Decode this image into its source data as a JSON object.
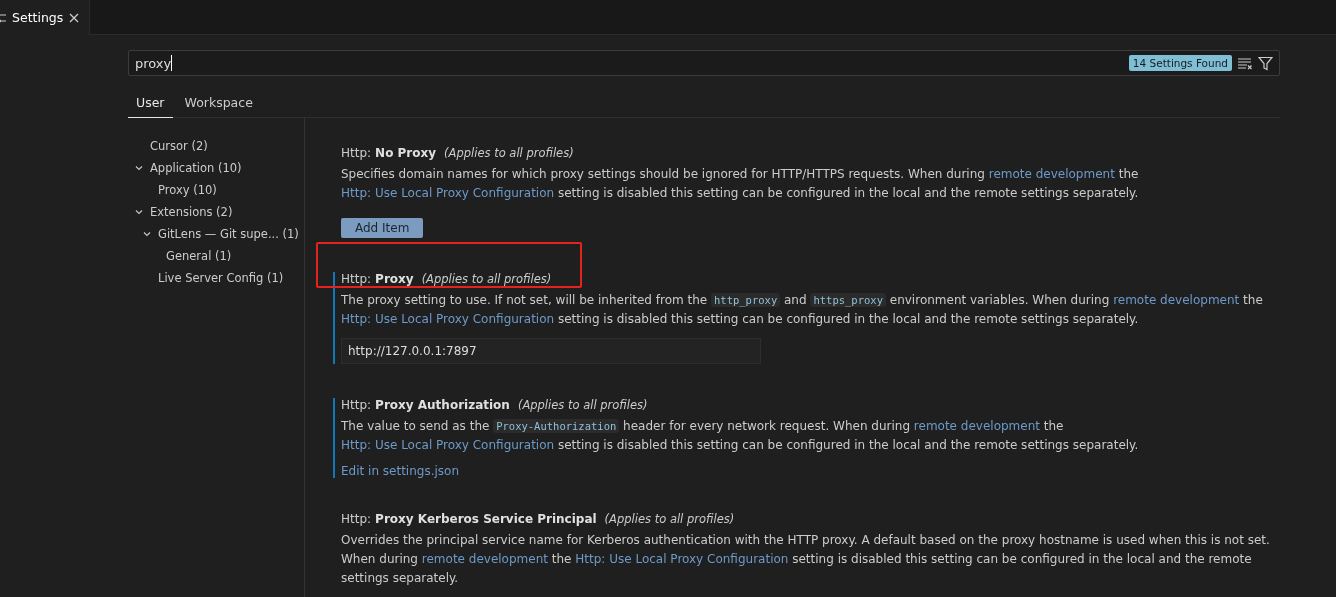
{
  "editor_tab": {
    "title": "Settings",
    "selected": true
  },
  "search": {
    "value": "proxy",
    "result_badge": "14 Settings Found"
  },
  "scope_tabs": [
    {
      "label": "User",
      "selected": true
    },
    {
      "label": "Workspace",
      "selected": false
    }
  ],
  "toc": [
    {
      "label": "Cursor (2)"
    },
    {
      "label": "Application (10)",
      "expanded": true,
      "children": [
        {
          "label": "Proxy (10)"
        }
      ]
    },
    {
      "label": "Extensions (2)",
      "expanded": true,
      "children": [
        {
          "label": "GitLens — Git supe... (1)",
          "expanded": true,
          "children": [
            {
              "label": "General (1)"
            }
          ]
        },
        {
          "label": "Live Server Config (1)"
        }
      ]
    }
  ],
  "settings": [
    {
      "category": "Http:",
      "name": "No Proxy",
      "scope": "(Applies to all profiles)",
      "focused": false,
      "highlighted": false,
      "description": [
        {
          "kind": "text",
          "text": "Specifies domain names for which proxy settings should be ignored for HTTP/HTTPS requests. When during "
        },
        {
          "kind": "link",
          "text": "remote development"
        },
        {
          "kind": "text",
          "text": " the "
        },
        {
          "kind": "link",
          "text": "Http: Use Local Proxy Configuration"
        },
        {
          "kind": "text",
          "text": " setting is disabled this setting can be configured in the local and the remote settings separately."
        }
      ],
      "control": {
        "kind": "button",
        "text": "Add Item"
      }
    },
    {
      "category": "Http:",
      "name": "Proxy",
      "scope": "(Applies to all profiles)",
      "focused": true,
      "highlighted": true,
      "description": [
        {
          "kind": "text",
          "text": "The proxy setting to use. If not set, will be inherited from the "
        },
        {
          "kind": "code",
          "text": "http_proxy"
        },
        {
          "kind": "text",
          "text": " and "
        },
        {
          "kind": "code",
          "text": "https_proxy"
        },
        {
          "kind": "text",
          "text": " environment variables. When during "
        },
        {
          "kind": "link",
          "text": "remote development"
        },
        {
          "kind": "text",
          "text": " the "
        },
        {
          "kind": "link",
          "text": "Http: Use Local Proxy Configuration"
        },
        {
          "kind": "text",
          "text": " setting is disabled this setting can be configured in the local and the remote settings separately."
        }
      ],
      "control": {
        "kind": "input",
        "text": "http://127.0.0.1:7897"
      }
    },
    {
      "category": "Http:",
      "name": "Proxy Authorization",
      "scope": "(Applies to all profiles)",
      "focused": true,
      "highlighted": false,
      "description": [
        {
          "kind": "text",
          "text": "The value to send as the "
        },
        {
          "kind": "code",
          "text": "Proxy-Authorization"
        },
        {
          "kind": "text",
          "text": " header for every network request. When during "
        },
        {
          "kind": "link",
          "text": "remote development"
        },
        {
          "kind": "text",
          "text": " the "
        },
        {
          "kind": "link",
          "text": "Http: Use Local Proxy Configuration"
        },
        {
          "kind": "text",
          "text": " setting is disabled this setting can be configured in the local and the remote settings separately."
        }
      ],
      "control": {
        "kind": "link",
        "text": "Edit in settings.json"
      }
    },
    {
      "category": "Http:",
      "name": "Proxy Kerberos Service Principal",
      "scope": "(Applies to all profiles)",
      "focused": false,
      "highlighted": false,
      "description": [
        {
          "kind": "text",
          "text": "Overrides the principal service name for Kerberos authentication with the HTTP proxy. A default based on the proxy hostname is used when this is not set. When during "
        },
        {
          "kind": "link",
          "text": "remote development"
        },
        {
          "kind": "text",
          "text": " the "
        },
        {
          "kind": "link",
          "text": "Http: Use Local Proxy Configuration"
        },
        {
          "kind": "text",
          "text": " setting is disabled this setting can be configured in the local and the remote settings separately."
        }
      ]
    }
  ]
}
